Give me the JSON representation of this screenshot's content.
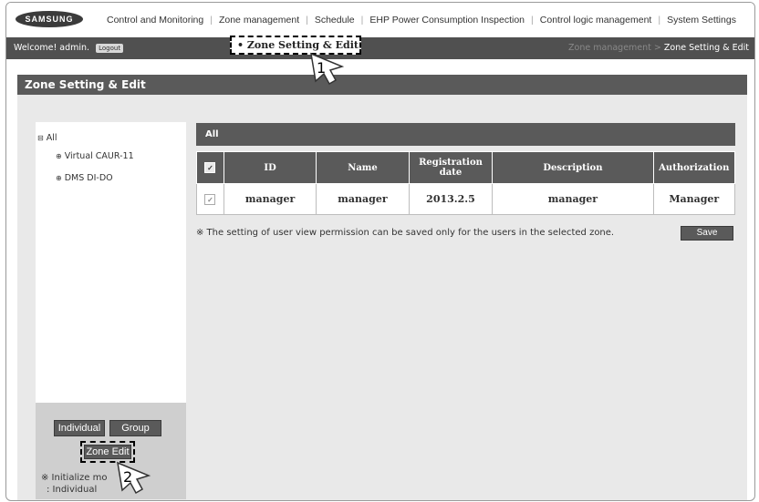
{
  "top_menu": {
    "logo": "SAMSUNG",
    "items": [
      "Control and Monitoring",
      "Zone management",
      "Schedule",
      "EHP Power Consumption Inspection",
      "Control logic management",
      "System Settings"
    ]
  },
  "subnav": {
    "welcome": "Welcome! admin.",
    "logout": "Logout",
    "breadcrumb_parent": "Zone management",
    "breadcrumb_separator": ">",
    "breadcrumb_current": "Zone Setting & Edit"
  },
  "dropdown": {
    "item": "• Zone Setting & Edit"
  },
  "page_title": "Zone Setting & Edit",
  "tree": {
    "root": "All",
    "children": [
      "Virtual CAUR-11",
      "DMS DI-DO"
    ]
  },
  "left_buttons": {
    "individual": "Individual",
    "group": "Group",
    "zone_edit": "Zone Edit"
  },
  "init_note": {
    "line1": "※ Initialize mo",
    "line2": ": Individual"
  },
  "panel": {
    "header": "All",
    "columns": [
      "",
      "ID",
      "Name",
      "Registration date",
      "Description",
      "Authorization"
    ],
    "rows": [
      {
        "checked": "✓",
        "id": "manager",
        "name": "manager",
        "registration_date": "2013.2.5",
        "description": "manager",
        "authorization": "Manager"
      }
    ],
    "header_check": "✓",
    "note": "※ The setting of user view permission can be saved only for the users in the selected zone.",
    "save": "Save"
  },
  "callouts": {
    "step1": "1",
    "step2": "2"
  },
  "colors": {
    "bar": "#5a5a5a",
    "subnav": "#505050",
    "panel_bg": "#e9e9e9"
  }
}
